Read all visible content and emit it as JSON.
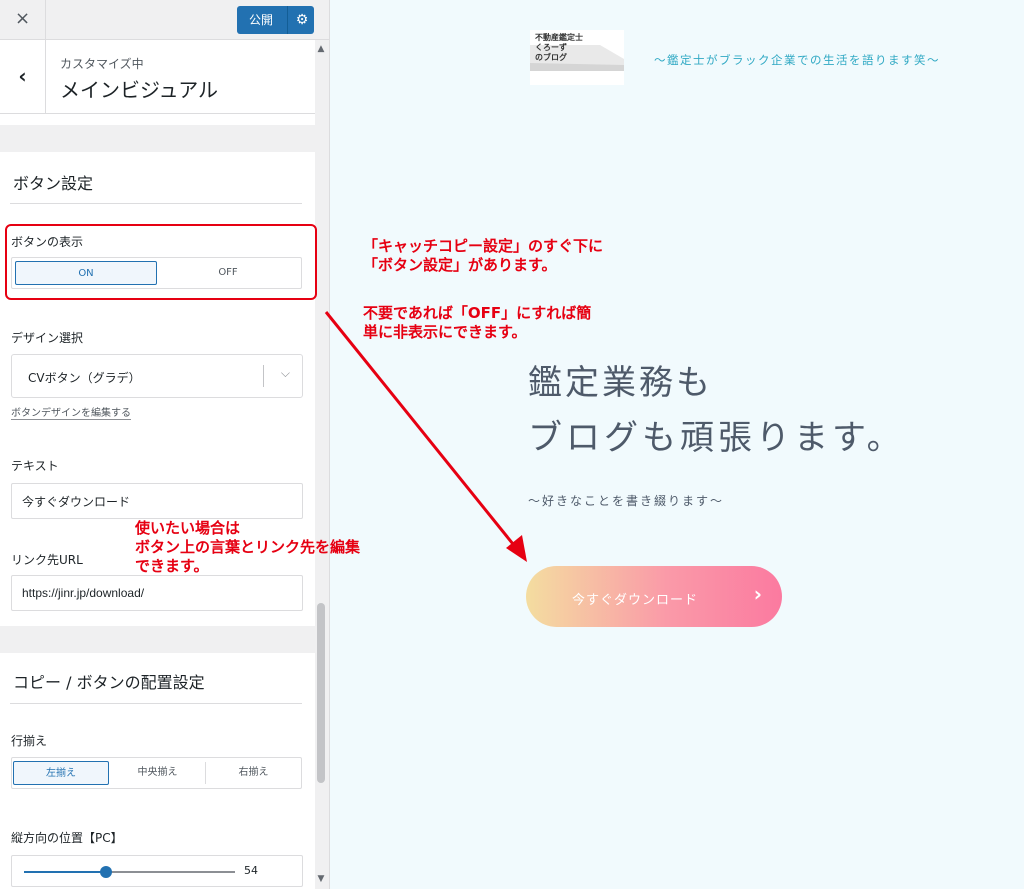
{
  "topbar": {
    "close_icon": "×",
    "publish_label": "公開",
    "gear_icon": "⚙"
  },
  "section": {
    "back_icon": "‹",
    "customizing": "カスタマイズ中",
    "title": "メインビジュアル"
  },
  "button_settings": {
    "title": "ボタン設定",
    "display_label": "ボタンの表示",
    "on": "ON",
    "off": "OFF",
    "selected": "ON",
    "design_label": "デザイン選択",
    "design_value": "CVボタン（グラデ）",
    "chevron_icon": "⌵",
    "edit_link": "ボタンデザインを編集する",
    "text_label": "テキスト",
    "text_value": "今すぐダウンロード",
    "link_label": "リンク先URL",
    "link_value": "https://jinr.jp/download/"
  },
  "layout_settings": {
    "title": "コピー / ボタンの配置設定",
    "align_label": "行揃え",
    "align_left": "左揃え",
    "align_center": "中央揃え",
    "align_right": "右揃え",
    "selected": "左揃え",
    "vertical_label": "縦方向の位置【PC】",
    "vertical_value": 54
  },
  "scrollbar": {
    "up": "▲",
    "down": "▼"
  },
  "preview": {
    "logo_text": "不動産鑑定士\nくろーず\nのブログ",
    "tagline": "～鑑定士がブラック企業での生活を語ります笑～",
    "hero_line1": "鑑定業務も",
    "hero_line2": "ブログも頑張ります。",
    "hero_sub": "～好きなことを書き綴ります～",
    "cta_label": "今すぐダウンロード",
    "cta_arrow": "›"
  },
  "annotations": {
    "note1": "「キャッチコピー設定」のすぐ下に\n「ボタン設定」があります。",
    "note2": "不要であれば「OFF」にすれば簡\n単に非表示にできます。",
    "note3": "使いたい場合は\nボタン上の言葉とリンク先を編集\nできます。"
  },
  "colors": {
    "accent": "#2271b1",
    "annotation": "#e60012",
    "preview_bg": "#f1fafd",
    "tagline": "#31a9c4"
  }
}
